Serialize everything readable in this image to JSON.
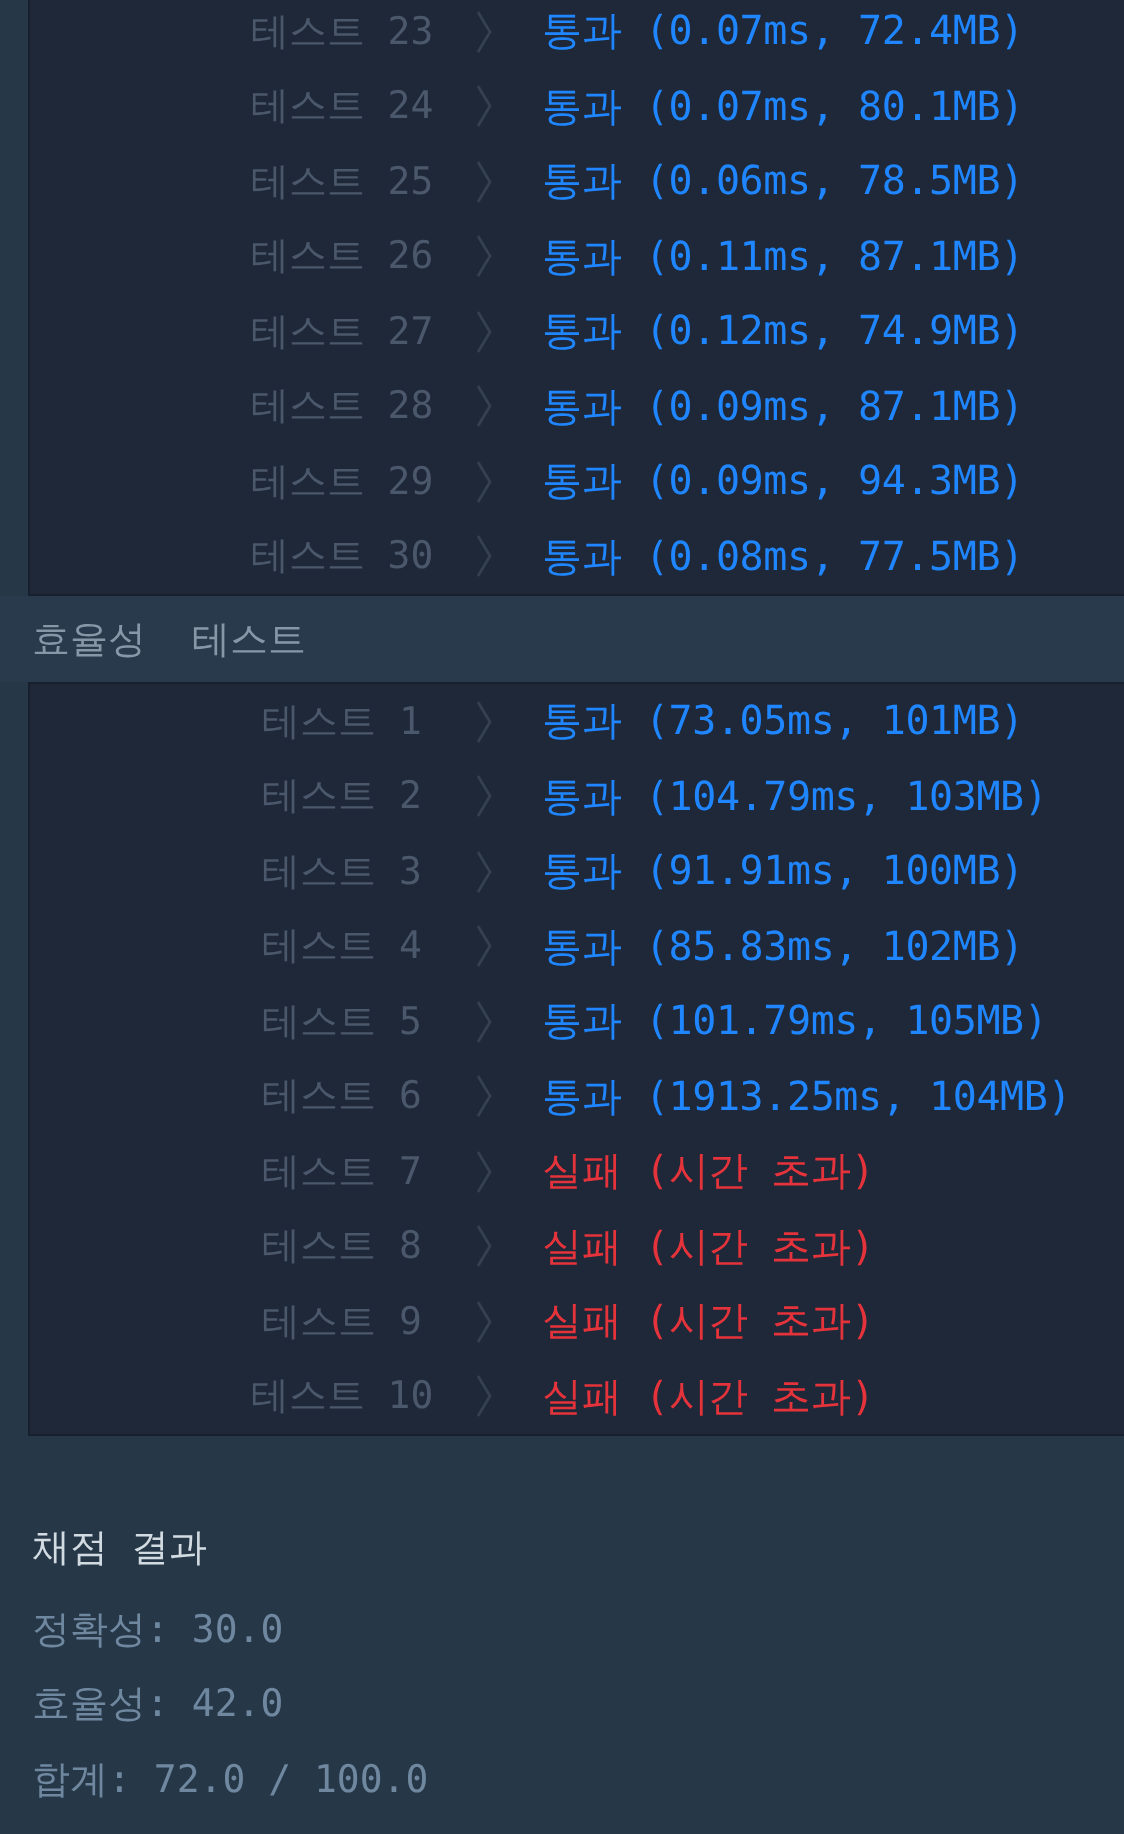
{
  "accuracy_tests": {
    "rows": [
      {
        "label": "테스트 23",
        "result": "통과 (0.07ms, 72.4MB)",
        "passed": true
      },
      {
        "label": "테스트 24",
        "result": "통과 (0.07ms, 80.1MB)",
        "passed": true
      },
      {
        "label": "테스트 25",
        "result": "통과 (0.06ms, 78.5MB)",
        "passed": true
      },
      {
        "label": "테스트 26",
        "result": "통과 (0.11ms, 87.1MB)",
        "passed": true
      },
      {
        "label": "테스트 27",
        "result": "통과 (0.12ms, 74.9MB)",
        "passed": true
      },
      {
        "label": "테스트 28",
        "result": "통과 (0.09ms, 87.1MB)",
        "passed": true
      },
      {
        "label": "테스트 29",
        "result": "통과 (0.09ms, 94.3MB)",
        "passed": true
      },
      {
        "label": "테스트 30",
        "result": "통과 (0.08ms, 77.5MB)",
        "passed": true
      }
    ]
  },
  "efficiency_tests": {
    "title": "효율성  테스트",
    "rows": [
      {
        "label": "테스트 1",
        "result": "통과 (73.05ms, 101MB)",
        "passed": true
      },
      {
        "label": "테스트 2",
        "result": "통과 (104.79ms, 103MB)",
        "passed": true
      },
      {
        "label": "테스트 3",
        "result": "통과 (91.91ms, 100MB)",
        "passed": true
      },
      {
        "label": "테스트 4",
        "result": "통과 (85.83ms, 102MB)",
        "passed": true
      },
      {
        "label": "테스트 5",
        "result": "통과 (101.79ms, 105MB)",
        "passed": true
      },
      {
        "label": "테스트 6",
        "result": "통과 (1913.25ms, 104MB)",
        "passed": true
      },
      {
        "label": "테스트 7",
        "result": "실패 (시간 초과)",
        "passed": false
      },
      {
        "label": "테스트 8",
        "result": "실패 (시간 초과)",
        "passed": false
      },
      {
        "label": "테스트 9",
        "result": "실패 (시간 초과)",
        "passed": false
      },
      {
        "label": "테스트 10",
        "result": "실패 (시간 초과)",
        "passed": false
      }
    ]
  },
  "score": {
    "title": "채점 결과",
    "lines": [
      "정확성: 30.0",
      "효율성: 42.0",
      "합계: 72.0 / 100.0"
    ]
  }
}
